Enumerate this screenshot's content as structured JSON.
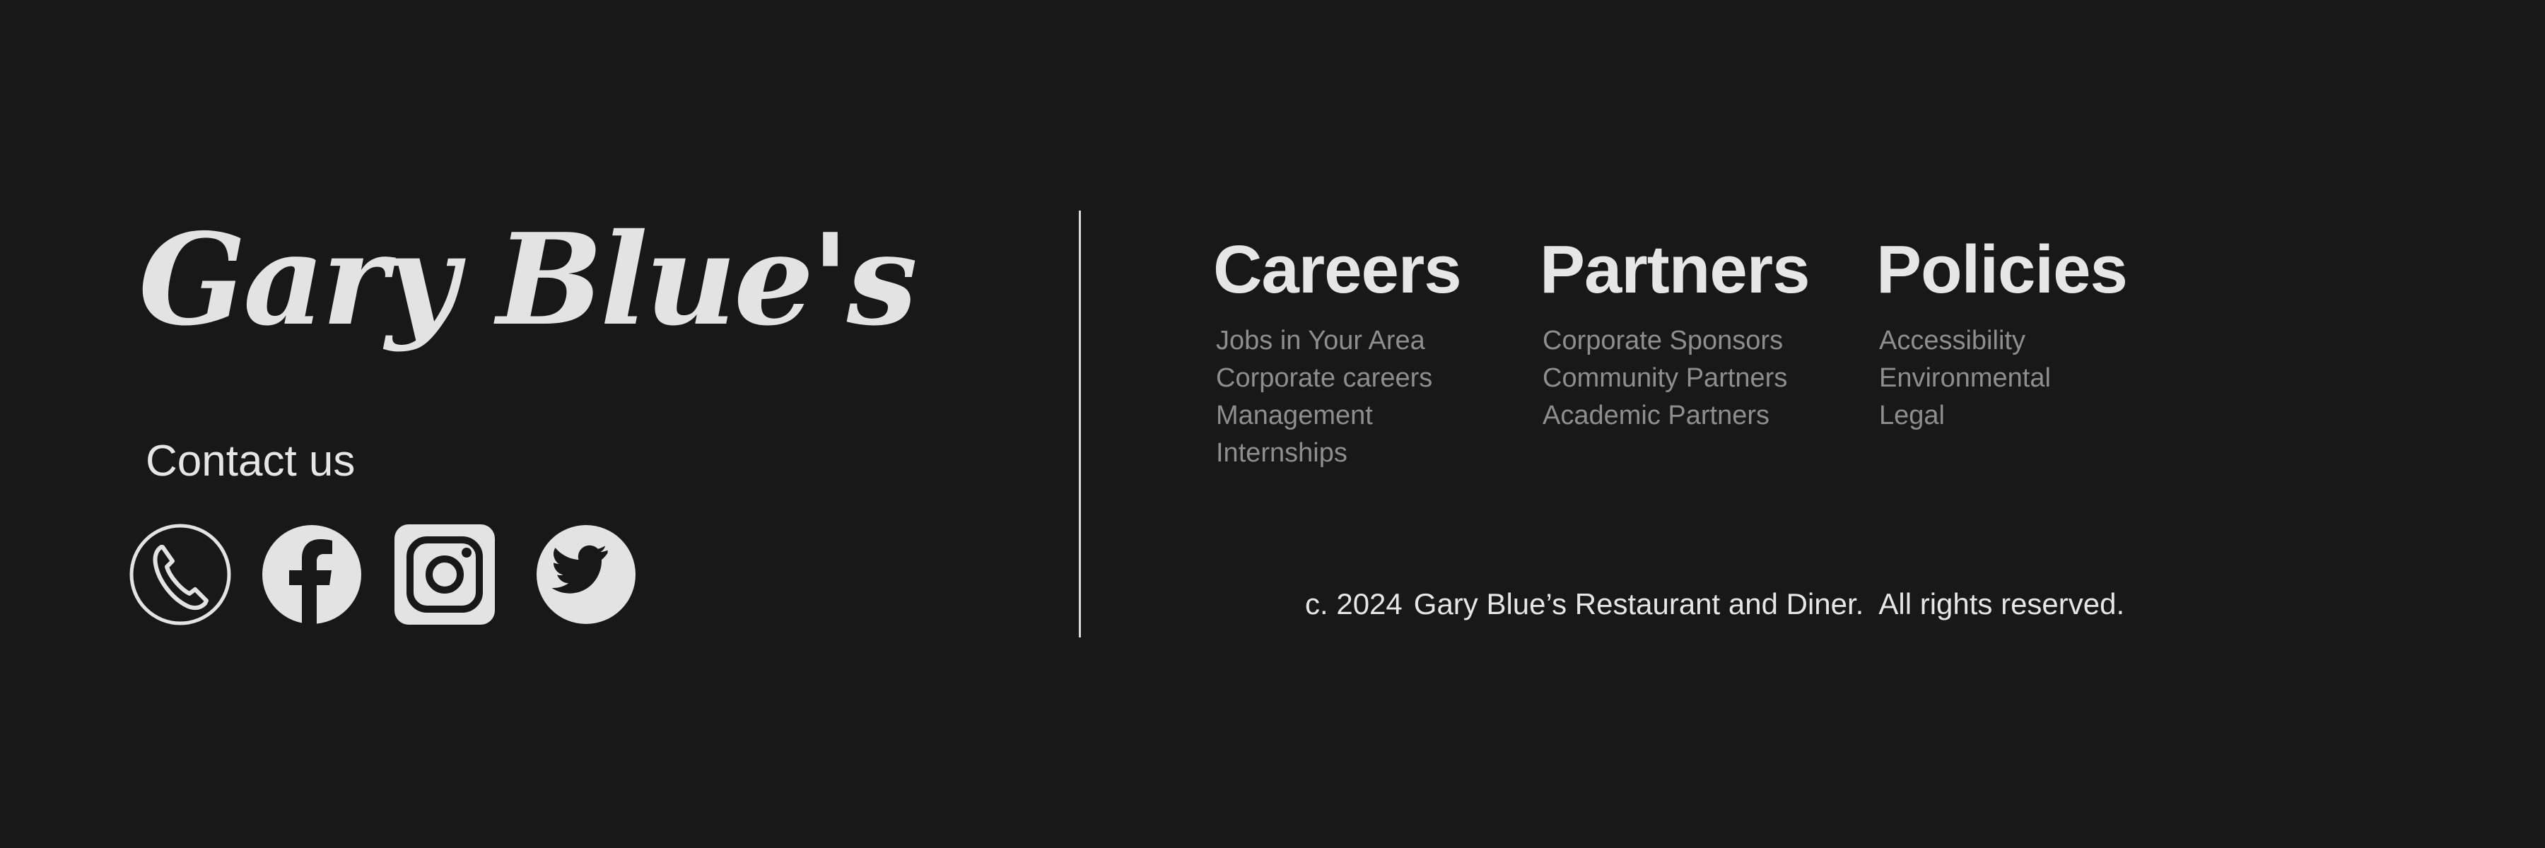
{
  "brand": {
    "name": "Gary Blue's"
  },
  "contact": {
    "label": "Contact us",
    "social": [
      {
        "name": "phone",
        "icon": "phone-icon"
      },
      {
        "name": "facebook",
        "icon": "facebook-icon"
      },
      {
        "name": "instagram",
        "icon": "instagram-icon"
      },
      {
        "name": "twitter",
        "icon": "twitter-icon"
      }
    ]
  },
  "nav": {
    "careers": {
      "heading": "Careers",
      "links": [
        "Jobs in Your Area",
        "Corporate careers",
        "Management",
        "Internships"
      ]
    },
    "partners": {
      "heading": "Partners",
      "links": [
        "Corporate Sponsors",
        "Community Partners",
        "Academic Partners"
      ]
    },
    "policies": {
      "heading": "Policies",
      "links": [
        "Accessibility",
        "Environmental",
        "Legal"
      ]
    }
  },
  "copyright": {
    "year": "c. 2024",
    "text": "Gary Blue’s Restaurant and Diner.  All rights reserved."
  },
  "colors": {
    "background": "#181818",
    "text": "#e6e6e6",
    "link": "#8e8e8e",
    "divider": "#d8d8d8"
  }
}
